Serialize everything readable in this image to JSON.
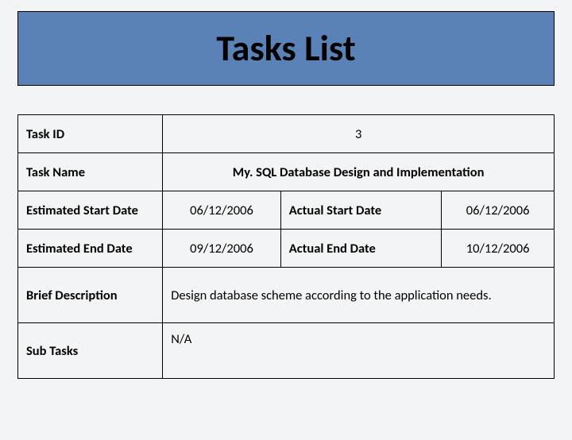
{
  "header": {
    "title": "Tasks List"
  },
  "labels": {
    "task_id": "Task ID",
    "task_name": "Task Name",
    "est_start": "Estimated Start Date",
    "act_start": "Actual Start Date",
    "est_end": "Estimated End Date",
    "act_end": "Actual End Date",
    "brief_desc": "Brief  Description",
    "sub_tasks": "Sub Tasks"
  },
  "task": {
    "id": "3",
    "name": "My. SQL Database Design  and Implementation",
    "est_start": "06/12/2006",
    "act_start": "06/12/2006",
    "est_end": "09/12/2006",
    "act_end": "10/12/2006",
    "brief_desc": "Design database scheme according to the application needs.",
    "sub_tasks": "N/A"
  }
}
